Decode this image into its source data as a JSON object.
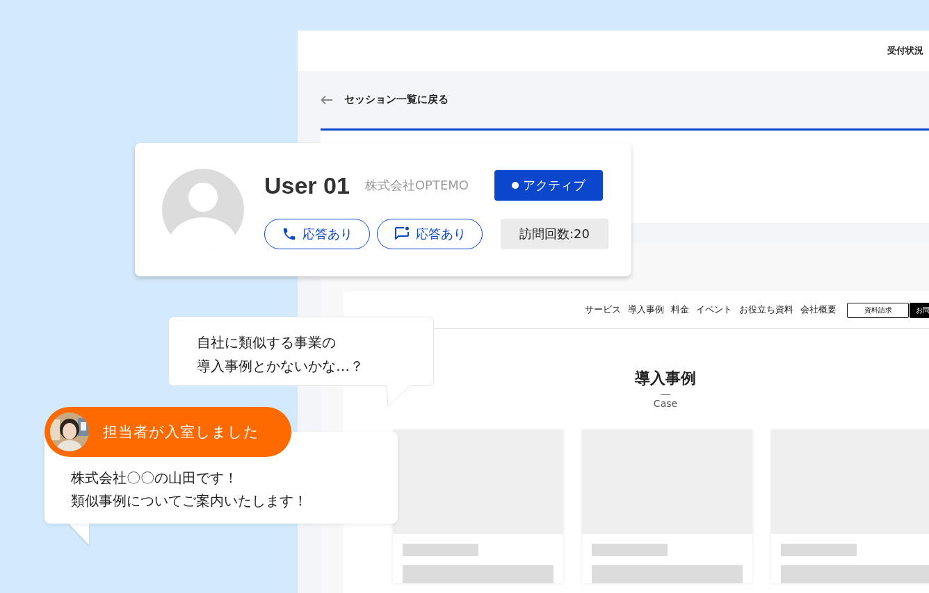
{
  "app": {
    "header_link": "受付状況",
    "back_link": "セッション一覧に戻る"
  },
  "profile": {
    "name": "User 01",
    "company": "株式会社OPTEMO",
    "status": {
      "label": "アクティブ",
      "active": true
    },
    "responses": [
      {
        "kind": "phone",
        "label": "応答あり"
      },
      {
        "kind": "chat",
        "label": "応答あり"
      }
    ],
    "visits": "訪問回数:20"
  },
  "site": {
    "nav": [
      "サービス",
      "導入事例",
      "料金",
      "イベント",
      "お役立ち資料",
      "会社概要"
    ],
    "buttons": [
      {
        "kind": "outline",
        "label": "資料請求"
      },
      {
        "kind": "solid",
        "label": "お問"
      }
    ],
    "heading": "導入事例",
    "subheading": "Case",
    "cards": [
      {
        "kind": "skeleton"
      },
      {
        "kind": "skeleton"
      },
      {
        "kind": "skeleton"
      }
    ]
  },
  "visitor_bubble": {
    "lines": [
      "自社に類似する事業の",
      "導入事例とかないかな…？"
    ]
  },
  "agent": {
    "notice": "担当者が入室しました",
    "avatar": {
      "kind": "picture"
    },
    "message": [
      "株式会社〇〇の山田です！",
      "類似事例についてご案内いたします！"
    ]
  }
}
